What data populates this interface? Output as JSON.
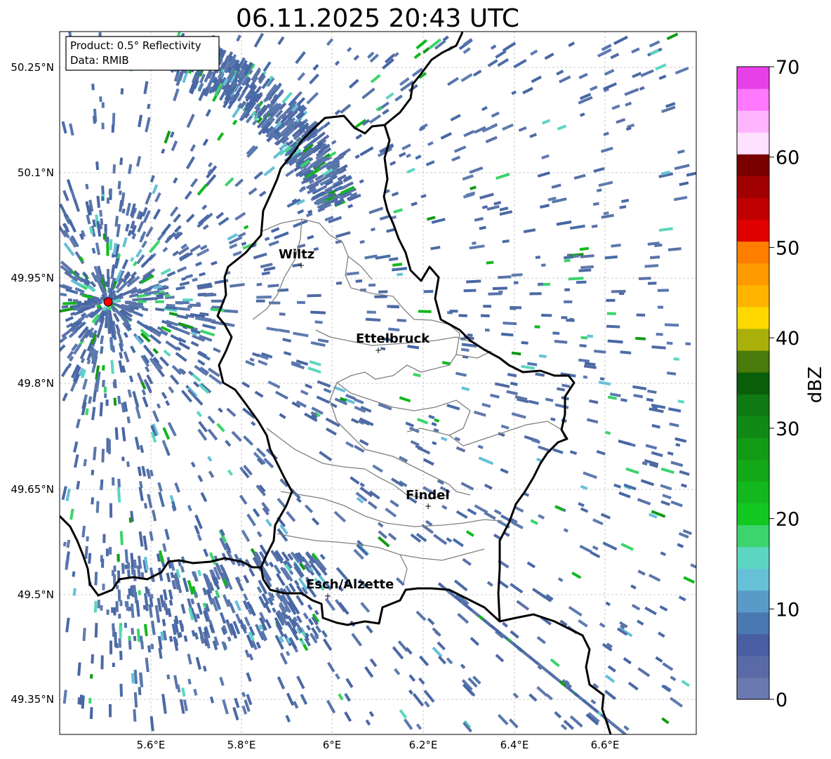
{
  "map": {
    "title": "06.11.2025 20:43 UTC",
    "info_box": {
      "product": "Product: 0.5° Reflectivity",
      "source": "Data: RMIB"
    },
    "lat_labels": [
      "50.25°N",
      "50.1°N",
      "49.95°N",
      "49.8°N",
      "49.65°N",
      "49.5°N",
      "49.35°N"
    ],
    "lon_labels": [
      "5.6°E",
      "5.8°E",
      "6°E",
      "6.2°E",
      "6.4°E",
      "6.6°E"
    ],
    "cities": [
      "Wiltz",
      "Ettelbruck",
      "Findel",
      "Esch/Alzette"
    ],
    "radar_marker": "radar-site",
    "colors": {
      "border": "#000000",
      "canton_lines": "#808080",
      "grid": "#bbbbbb",
      "radar_site": "#ff0000"
    }
  },
  "colorbar": {
    "label": "dBZ",
    "ticks": [
      "0",
      "10",
      "20",
      "30",
      "40",
      "50",
      "60",
      "70"
    ],
    "range": [
      0,
      70
    ],
    "colors": [
      "#6a7ab0",
      "#5a6aa6",
      "#4a5ea4",
      "#4a78b0",
      "#5a9ac8",
      "#66c0d8",
      "#5cd6c0",
      "#3cd46c",
      "#12c820",
      "#12b81e",
      "#12a818",
      "#129a16",
      "#108a14",
      "#0e7a12",
      "#0a5e0a",
      "#4a7a0a",
      "#aab00a",
      "#ffd800",
      "#ffb400",
      "#ff9a00",
      "#ff7e00",
      "#e00000",
      "#c00000",
      "#a00000",
      "#7a0000",
      "#ffe0ff",
      "#ffb4ff",
      "#ff78ff",
      "#e840e8"
    ]
  }
}
